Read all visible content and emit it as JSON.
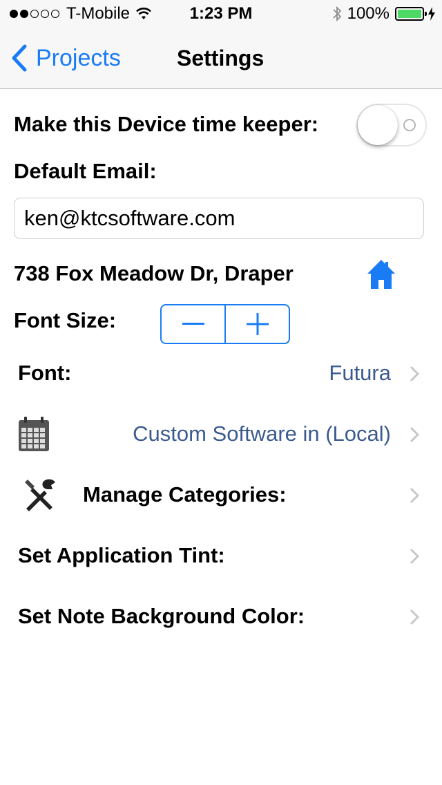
{
  "status_bar": {
    "carrier": "T-Mobile",
    "time": "1:23 PM",
    "battery": "100%"
  },
  "nav": {
    "back_label": "Projects",
    "title": "Settings"
  },
  "timekeeper": {
    "label": "Make this Device time keeper:",
    "on": false
  },
  "email": {
    "label": "Default Email:",
    "value": "ken@ktcsoftware.com"
  },
  "address": {
    "text": "738 Fox Meadow Dr, Draper"
  },
  "font_size": {
    "label": "Font Size:",
    "decrement": "−",
    "increment": "+"
  },
  "font": {
    "label": "Font:",
    "value": "Futura"
  },
  "calendar": {
    "value": "Custom Software in (Local)"
  },
  "categories": {
    "label": "Manage Categories:"
  },
  "tint": {
    "label": "Set Application Tint:"
  },
  "note_bg": {
    "label": "Set Note Background Color:"
  },
  "colors": {
    "accent": "#1a7cf5",
    "value_text": "#3b5a8f",
    "battery": "#4cd964",
    "toggle_border": "#e5e5e5"
  }
}
